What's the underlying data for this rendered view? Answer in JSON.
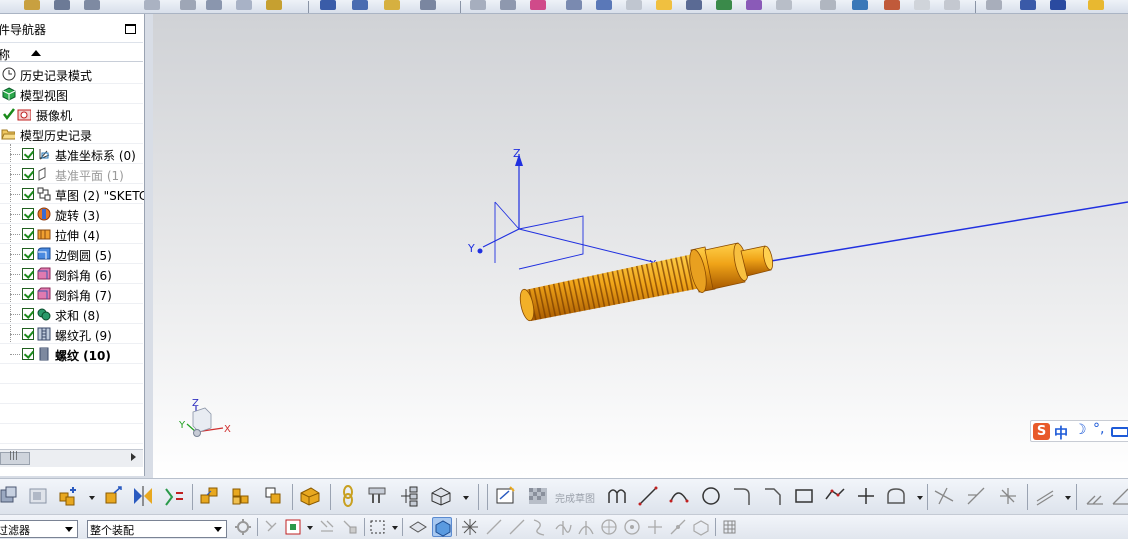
{
  "navigator": {
    "title": "件导航器",
    "column_header": "称",
    "items": [
      {
        "label": "历史记录模式",
        "icon": "clock-icon",
        "level": 0
      },
      {
        "label": "模型视图",
        "icon": "model-views-icon",
        "level": 0
      },
      {
        "label": "摄像机",
        "icon": "camera-icon",
        "level": 0
      },
      {
        "label": "模型历史记录",
        "icon": "folder-open-icon",
        "level": 0
      },
      {
        "label": "基准坐标系 (0)",
        "icon": "datum-csys-icon",
        "level": 1
      },
      {
        "label": "基准平面 (1)",
        "icon": "datum-plane-icon",
        "level": 1,
        "dimmed": true
      },
      {
        "label": "草图 (2) \"SKETC",
        "icon": "sketch-icon",
        "level": 1
      },
      {
        "label": "旋转 (3)",
        "icon": "revolve-icon",
        "level": 1
      },
      {
        "label": "拉伸 (4)",
        "icon": "extrude-icon",
        "level": 1
      },
      {
        "label": "边倒圆 (5)",
        "icon": "edge-blend-icon",
        "level": 1
      },
      {
        "label": "倒斜角 (6)",
        "icon": "chamfer-icon",
        "level": 1
      },
      {
        "label": "倒斜角 (7)",
        "icon": "chamfer-icon",
        "level": 1
      },
      {
        "label": "求和 (8)",
        "icon": "unite-icon",
        "level": 1
      },
      {
        "label": "螺纹孔 (9)",
        "icon": "threaded-hole-icon",
        "level": 1
      },
      {
        "label": "螺纹 (10)",
        "icon": "thread-icon",
        "level": 1,
        "bold": true
      }
    ]
  },
  "viewport": {
    "csys_axes": {
      "z": "Z",
      "y": "Y",
      "x": "X"
    },
    "triad_axes": {
      "z": "Z",
      "y": "Y",
      "x": "X"
    }
  },
  "ime": {
    "logo": "S",
    "mode": "中",
    "moon": "☽",
    "punct": "°,"
  },
  "toolbar": {
    "sketch_label": "完成草图"
  },
  "selection_bar": {
    "filter_value": "过滤器",
    "scope_value": "整个装配"
  },
  "colors": {
    "part": "#f0a010",
    "axis": "#2030e0",
    "check": "#1a8a1a"
  }
}
